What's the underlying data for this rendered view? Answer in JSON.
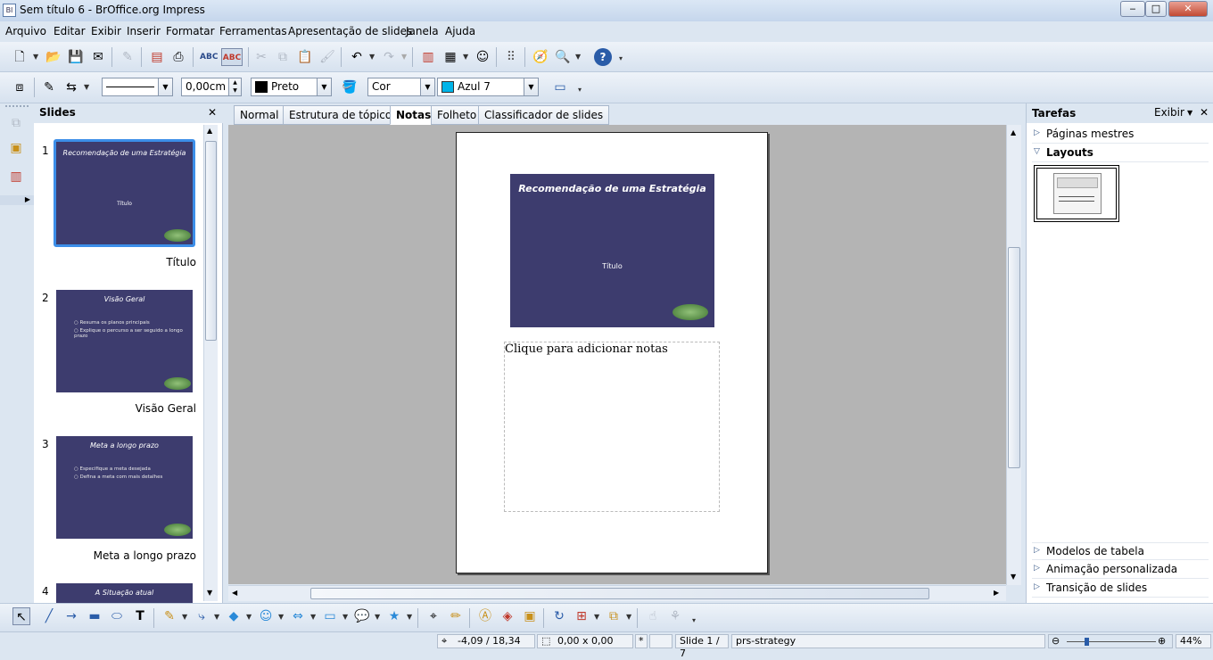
{
  "window": {
    "title": "Sem título 6 - BrOffice.org Impress",
    "minimize": "‒",
    "maximize": "□",
    "close": "✕"
  },
  "menu": [
    "Arquivo",
    "Editar",
    "Exibir",
    "Inserir",
    "Formatar",
    "Ferramentas",
    "Apresentação de slides",
    "Janela",
    "Ajuda"
  ],
  "line_toolbar": {
    "line_width": "0,00cm",
    "line_color": "Preto",
    "area_type": "Cor",
    "area_color": "Azul 7"
  },
  "colors": {
    "slide_bg": "#3d3c6e",
    "area_swatch": "#00b4e8",
    "line_swatch": "#000000",
    "selection": "#3c8ee8"
  },
  "slides_panel": {
    "title": "Slides",
    "close": "✕",
    "slides": [
      {
        "number": "1",
        "name": "Título",
        "title": "Recomendação de uma Estratégia",
        "subtitle": "Título",
        "bullets": []
      },
      {
        "number": "2",
        "name": "Visão Geral",
        "title": "Visão Geral",
        "subtitle": "",
        "bullets": [
          "Resuma os planos principais",
          "Explique o percurso a ser seguido a longo prazo"
        ]
      },
      {
        "number": "3",
        "name": "Meta a longo prazo",
        "title": "Meta a longo prazo",
        "subtitle": "",
        "bullets": [
          "Especifique a meta desejada",
          "Defina a meta com mais detalhes"
        ]
      },
      {
        "number": "4",
        "name": "",
        "title": "A Situação atual",
        "subtitle": "",
        "bullets": []
      }
    ]
  },
  "tabs": [
    "Normal",
    "Estrutura de tópicos",
    "Notas",
    "Folheto",
    "Classificador de slides"
  ],
  "active_tab": "Notas",
  "notes_page": {
    "slide_title": "Recomendação de uma Estratégia",
    "slide_subtitle": "Título",
    "notes_placeholder": "Clique para adicionar notas"
  },
  "tasks_panel": {
    "title": "Tarefas",
    "view_label": "Exibir",
    "close": "✕",
    "sections_top": [
      {
        "label": "Páginas mestres",
        "expanded": false
      },
      {
        "label": "Layouts",
        "expanded": true
      }
    ],
    "sections_bottom": [
      {
        "label": "Modelos de tabela"
      },
      {
        "label": "Animação personalizada"
      },
      {
        "label": "Transição de slides"
      }
    ]
  },
  "status": {
    "position": "-4,09 / 18,34",
    "size": "0,00 x 0,00",
    "modified": "*",
    "slide": "Slide 1 / 7",
    "master": "prs-strategy",
    "zoom": "44%",
    "zoom_level": 0.44
  }
}
